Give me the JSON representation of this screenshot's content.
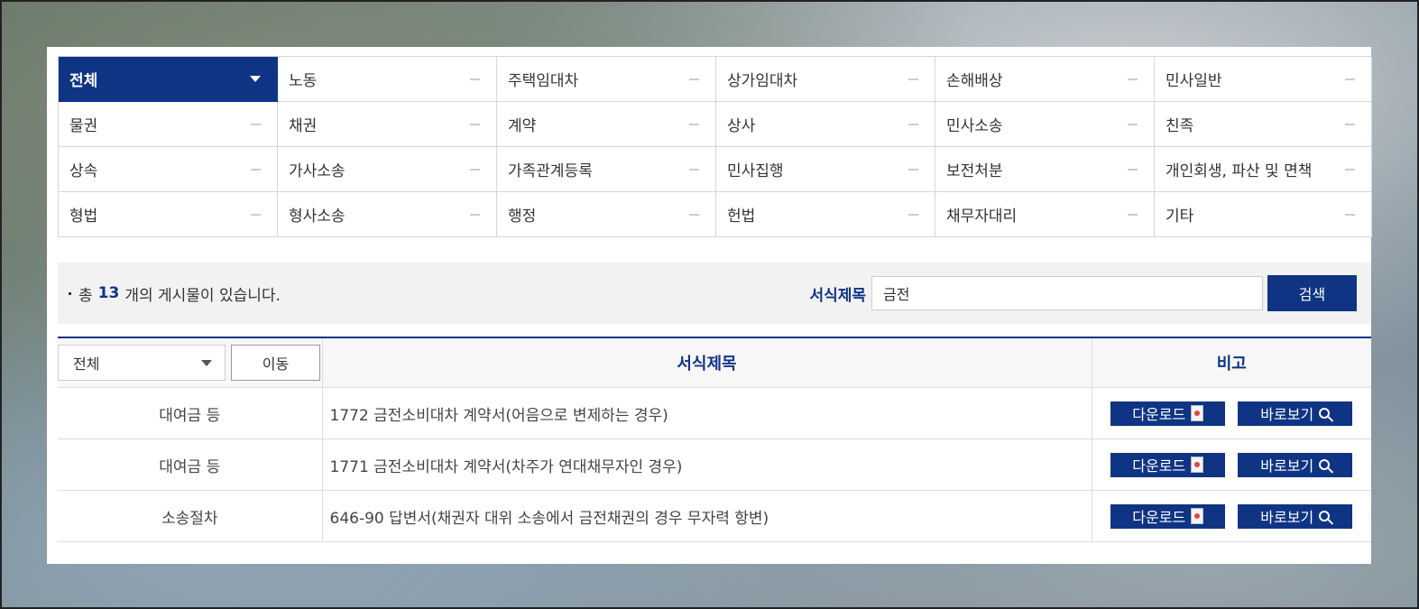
{
  "categories": [
    {
      "label": "전체",
      "active": true
    },
    {
      "label": "노동"
    },
    {
      "label": "주택임대차"
    },
    {
      "label": "상가임대차"
    },
    {
      "label": "손해배상"
    },
    {
      "label": "민사일반"
    },
    {
      "label": "물권"
    },
    {
      "label": "채권"
    },
    {
      "label": "계약"
    },
    {
      "label": "상사"
    },
    {
      "label": "민사소송"
    },
    {
      "label": "친족"
    },
    {
      "label": "상속"
    },
    {
      "label": "가사소송"
    },
    {
      "label": "가족관계등록"
    },
    {
      "label": "민사집행"
    },
    {
      "label": "보전처분"
    },
    {
      "label": "개인회생, 파산 및 면책"
    },
    {
      "label": "형법"
    },
    {
      "label": "형사소송"
    },
    {
      "label": "행정"
    },
    {
      "label": "헌법"
    },
    {
      "label": "채무자대리"
    },
    {
      "label": "기타"
    }
  ],
  "summary": {
    "prefix": "총",
    "count": "13",
    "suffix": "개의 게시물이 있습니다."
  },
  "search": {
    "label": "서식제목",
    "value": "금전",
    "button": "검색"
  },
  "filter": {
    "selected": "전체",
    "move_button": "이동"
  },
  "table": {
    "headers": {
      "title": "서식제목",
      "note": "비고"
    },
    "rows": [
      {
        "category": "대여금 등",
        "title": "1772 금전소비대차 계약서(어음으로 변제하는 경우)"
      },
      {
        "category": "대여금 등",
        "title": "1771 금전소비대차 계약서(차주가 연대채무자인 경우)"
      },
      {
        "category": "소송절차",
        "title": "646-90 답변서(채권자 대위 소송에서 금전채권의 경우 무자력 항변)"
      }
    ],
    "download_label": "다운로드",
    "view_label": "바로보기"
  }
}
